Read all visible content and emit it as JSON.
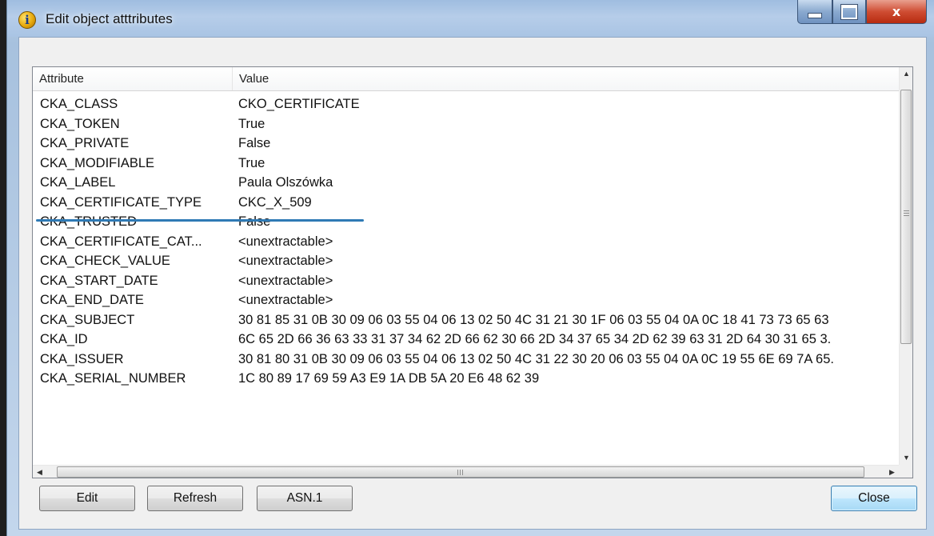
{
  "window": {
    "title": "Edit object atttributes",
    "info_glyph": "i",
    "controls": [
      "minimize-icon",
      "maximize-icon",
      "close-icon"
    ],
    "close_glyph": "x"
  },
  "table": {
    "columns": [
      "Attribute",
      "Value"
    ],
    "rows": [
      {
        "attr": "CKA_CLASS",
        "value": "CKO_CERTIFICATE"
      },
      {
        "attr": "CKA_TOKEN",
        "value": "True"
      },
      {
        "attr": "CKA_PRIVATE",
        "value": "False"
      },
      {
        "attr": "CKA_MODIFIABLE",
        "value": "True"
      },
      {
        "attr": "CKA_LABEL",
        "value": "Paula Olszówka"
      },
      {
        "attr": "CKA_CERTIFICATE_TYPE",
        "value": "CKC_X_509"
      },
      {
        "attr": "CKA_TRUSTED",
        "value": "False"
      },
      {
        "attr": "CKA_CERTIFICATE_CAT...",
        "value": "<unextractable>"
      },
      {
        "attr": "CKA_CHECK_VALUE",
        "value": "<unextractable>"
      },
      {
        "attr": "CKA_START_DATE",
        "value": "<unextractable>"
      },
      {
        "attr": "CKA_END_DATE",
        "value": "<unextractable>"
      },
      {
        "attr": "CKA_SUBJECT",
        "value": "30 81 85 31 0B 30 09 06 03 55 04 06 13 02 50 4C 31 21 30 1F 06 03 55 04 0A 0C 18 41 73 73 65 63"
      },
      {
        "attr": "CKA_ID",
        "value": "6C 65 2D 66 36 63 33 31 37 34 62 2D 66 62 30 66 2D 34 37 65 34 2D 62 39 63 31 2D 64 30 31 65 3."
      },
      {
        "attr": "CKA_ISSUER",
        "value": "30 81 80 31 0B 30 09 06 03 55 04 06 13 02 50 4C 31 22 30 20 06 03 55 04 0A 0C 19 55 6E 69 7A 65."
      },
      {
        "attr": "CKA_SERIAL_NUMBER",
        "value": "1C 80 89 17 69 59 A3 E9 1A DB 5A 20 E6 48 62 39"
      }
    ],
    "highlighted_row": "CKA_LABEL"
  },
  "scroll": {
    "up_glyph": "▲",
    "down_glyph": "▼",
    "left_glyph": "◀",
    "right_glyph": "▶"
  },
  "buttons": {
    "edit": "Edit",
    "refresh": "Refresh",
    "asn1": "ASN.1",
    "close": "Close"
  },
  "colors": {
    "title_bar": "#b6cde9",
    "close_button": "#c7432a",
    "highlight_underline": "#2f7ab5",
    "default_button": "#bee6fd"
  }
}
